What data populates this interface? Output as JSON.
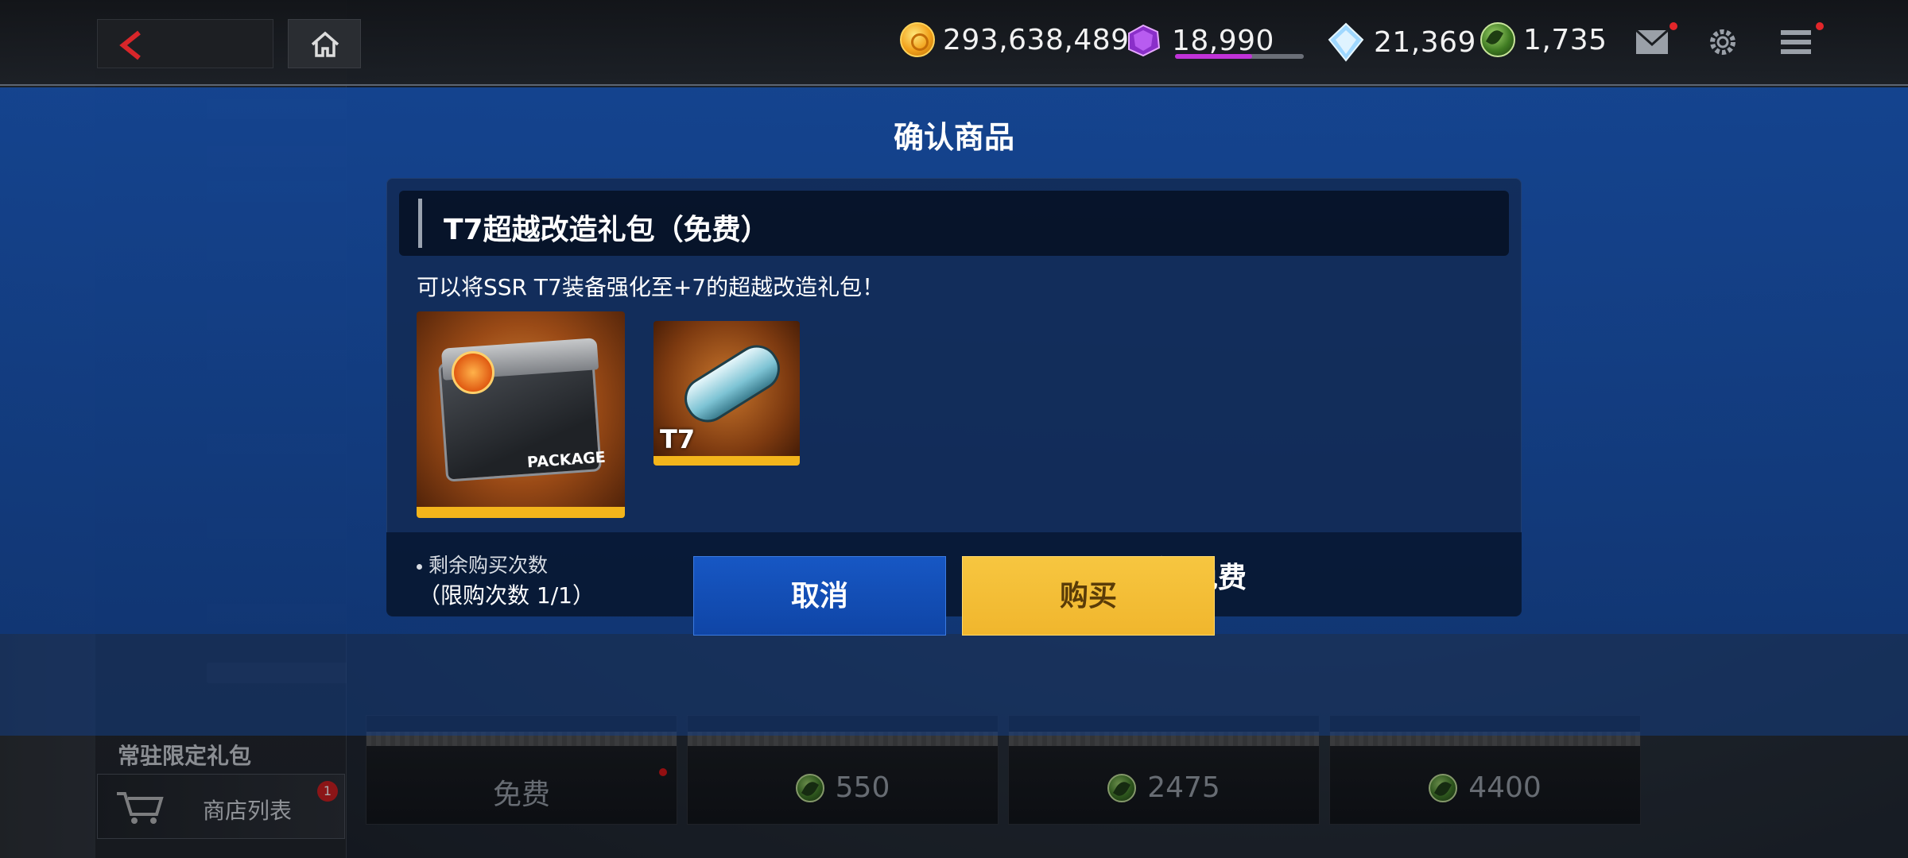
{
  "currencies": {
    "gold": "293,638,489",
    "purple_gem": "18,990",
    "purple_gem_progress": 0.6,
    "diamond": "21,369",
    "leaf_token": "1,735"
  },
  "background": {
    "section_title": "常驻限定礼包",
    "shop_list_label": "商店列表",
    "shop_list_badge": "1",
    "cards": [
      {
        "price": "免费",
        "has_icon": false,
        "has_dot": true
      },
      {
        "price": "550",
        "has_icon": true,
        "has_dot": false
      },
      {
        "price": "2475",
        "has_icon": true,
        "has_dot": false
      },
      {
        "price": "4400",
        "has_icon": true,
        "has_dot": false
      }
    ]
  },
  "modal": {
    "title": "确认商品",
    "product_name": "T7超越改造礼包（免费）",
    "description": "可以将SSR T7装备强化至+7的超越改造礼包！",
    "items": [
      {
        "label": "PACKAGE",
        "rarity_color": "#f3b51b"
      },
      {
        "label": "T7",
        "rarity_color": "#f3b51b"
      }
    ],
    "remaining_label": "剩余购买次数",
    "remaining_value": "（限购次数 1/1）",
    "price": "免费",
    "cancel_label": "取消",
    "buy_label": "购买"
  },
  "colors": {
    "modal_blue": "#14469a",
    "buy_yellow": "#f3c23a",
    "cancel_blue": "#1452b8",
    "rarity_gold": "#f3b51b"
  }
}
